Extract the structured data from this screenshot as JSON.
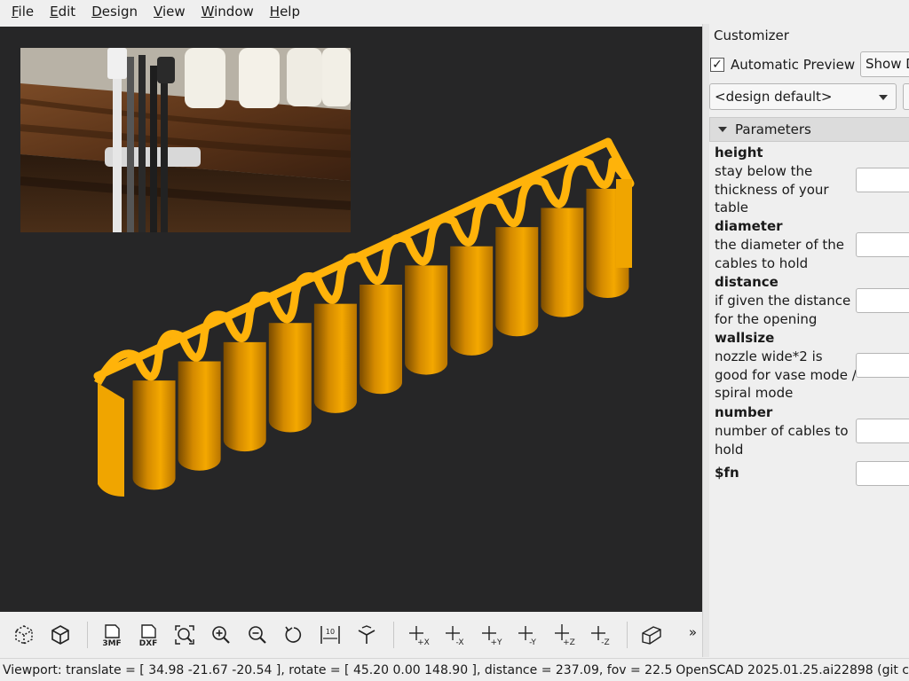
{
  "menu": {
    "items": [
      {
        "label": "File",
        "key": "F",
        "rest": "ile"
      },
      {
        "label": "Edit",
        "key": "E",
        "rest": "dit"
      },
      {
        "label": "Design",
        "key": "D",
        "rest": "esign"
      },
      {
        "label": "View",
        "key": "V",
        "rest": "iew"
      },
      {
        "label": "Window",
        "key": "W",
        "rest": "indow"
      },
      {
        "label": "Help",
        "key": "H",
        "rest": "elp"
      }
    ]
  },
  "viewport": {
    "background": "#262627",
    "model_color": "#f0a500",
    "model_edge_color": "#ffb30a",
    "model_shadow_color": "#6e4400"
  },
  "toolbar": {
    "buttons": [
      {
        "name": "preview-button",
        "icon": "preview-cube-icon"
      },
      {
        "name": "render-button",
        "icon": "render-cube-icon"
      },
      {
        "name": "export-3mf-button",
        "icon": "export-3mf-icon",
        "label": "3MF"
      },
      {
        "name": "export-dxf-button",
        "icon": "export-dxf-icon",
        "label": "DXF"
      },
      {
        "name": "view-all-button",
        "icon": "zoom-fit-icon"
      },
      {
        "name": "zoom-in-button",
        "icon": "zoom-in-icon"
      },
      {
        "name": "zoom-out-button",
        "icon": "zoom-out-icon"
      },
      {
        "name": "reset-view-button",
        "icon": "reset-view-icon"
      },
      {
        "name": "perspective-button",
        "icon": "scale-markers-icon",
        "label": "10"
      },
      {
        "name": "show-axes-button",
        "icon": "axes-icon"
      },
      {
        "name": "view-right-button",
        "icon": "view-right-icon",
        "label": "+X"
      },
      {
        "name": "view-left-button",
        "icon": "view-left-icon",
        "label": "-X"
      },
      {
        "name": "view-back-button",
        "icon": "view-back-icon",
        "label": "+Y"
      },
      {
        "name": "view-front-button",
        "icon": "view-front-icon",
        "label": "-Y"
      },
      {
        "name": "view-top-button",
        "icon": "view-top-icon",
        "label": "+Z"
      },
      {
        "name": "view-bottom-button",
        "icon": "view-bottom-icon",
        "label": "-Z"
      },
      {
        "name": "view-perspective-button",
        "icon": "perspective-box-icon"
      }
    ],
    "more_label": "»"
  },
  "status": {
    "viewport_text": "Viewport: translate = [ 34.98 -21.67 -20.54 ], rotate = [ 45.20 0.00 148.90 ], distance = 237.09, fov = 22.50 (62",
    "version_text": "OpenSCAD 2025.01.25.ai22898 (git c"
  },
  "customizer": {
    "title": "Customizer",
    "automatic_preview_label": "Automatic Preview",
    "automatic_preview_checked": true,
    "check_mark": "✓",
    "show_details_label": "Show D",
    "preset_value": "<design default>",
    "section_label": "Parameters",
    "params": [
      {
        "name": "height",
        "desc": "stay below the thickness of your table",
        "value": ""
      },
      {
        "name": "diameter",
        "desc": "the diameter of the cables to hold",
        "value": ""
      },
      {
        "name": "distance",
        "desc": "if given the distance for the opening",
        "value": ""
      },
      {
        "name": "wallsize",
        "desc": "nozzle wide*2 is good for vase mode / spiral mode",
        "value": ""
      },
      {
        "name": "number",
        "desc": "number of cables to hold",
        "value": ""
      },
      {
        "name": "$fn",
        "desc": "",
        "value": ""
      }
    ]
  }
}
